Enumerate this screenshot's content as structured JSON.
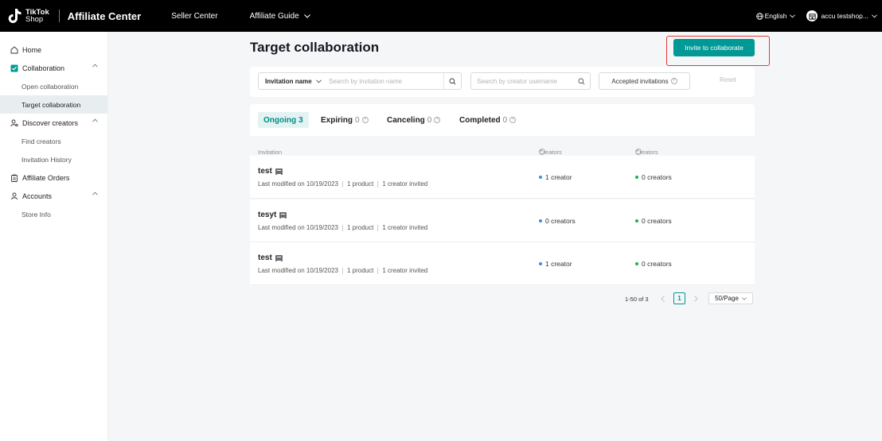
{
  "topbar": {
    "logo_line1": "TikTok",
    "logo_line2": "Shop",
    "app_title": "Affiliate Center",
    "nav_seller_center": "Seller Center",
    "nav_affiliate_guide": "Affiliate Guide",
    "language": "English",
    "shop_name": "accu testshop..."
  },
  "sidebar": {
    "home": "Home",
    "collaboration": "Collaboration",
    "open_collaboration": "Open collaboration",
    "target_collaboration": "Target collaboration",
    "discover_creators": "Discover creators",
    "find_creators": "Find creators",
    "invitation_history": "Invitation History",
    "affiliate_orders": "Affiliate Orders",
    "accounts": "Accounts",
    "store_info": "Store Info"
  },
  "page": {
    "title": "Target collaboration",
    "invite_button": "Invite to collaborate"
  },
  "filters": {
    "select_label": "Invitation name",
    "invitation_placeholder": "Search by invitation name",
    "creator_placeholder": "Search by creator username",
    "accepted_label": "Accepted invitations",
    "reset": "Reset"
  },
  "tabs": [
    {
      "label": "Ongoing",
      "count": "3"
    },
    {
      "label": "Expiring",
      "count": "0"
    },
    {
      "label": "Canceling",
      "count": "0"
    },
    {
      "label": "Completed",
      "count": "0"
    }
  ],
  "table": {
    "headers": {
      "invitation": "Invitation",
      "accepted": "Creators accepted",
      "promoted": "Creators promoted"
    },
    "rows": [
      {
        "name": "test",
        "modified": "Last modified on 10/19/2023",
        "product": "1 product",
        "invited": "1 creator invited",
        "accepted": "1 creator",
        "promoted": "0 creators"
      },
      {
        "name": "tesyt",
        "modified": "Last modified on 10/19/2023",
        "product": "1 product",
        "invited": "1 creator invited",
        "accepted": "0 creators",
        "promoted": "0 creators"
      },
      {
        "name": "test",
        "modified": "Last modified on 10/19/2023",
        "product": "1 product",
        "invited": "1 creator invited",
        "accepted": "1 creator",
        "promoted": "0 creators"
      }
    ]
  },
  "pagination": {
    "range": "1-50 of 3",
    "current_page": "1",
    "page_size": "50/Page"
  },
  "colors": {
    "accent": "#009995",
    "accepted_dot": "#3d8ee0",
    "promoted_dot": "#1aae5a",
    "highlight": "#e23b3b"
  }
}
